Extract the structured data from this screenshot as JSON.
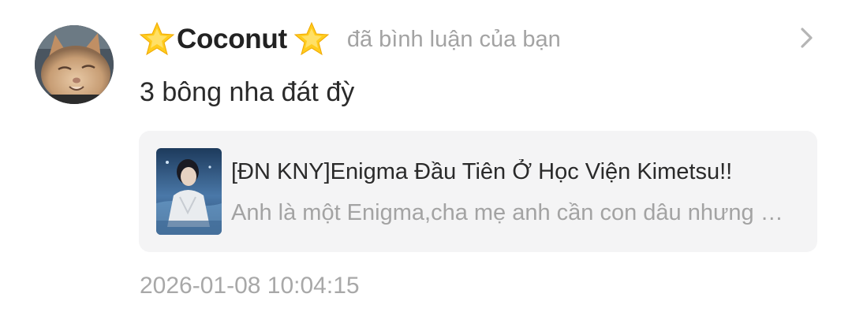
{
  "notification": {
    "user_name": "Coconut",
    "action": "đã bình luận của bạn",
    "comment": "3 bông nha đát đỳ",
    "story": {
      "title": "[ĐN KNY]Enigma Đầu Tiên Ở Học Viện Kimetsu!!",
      "description": "Anh là một Enigma,cha mẹ anh cần con dâu nhưng anh cũng chẳng biết phải làm sao"
    },
    "timestamp": "2026-01-08 10:04:15"
  },
  "icons": {
    "avatar": "cat-avatar",
    "name_decoration": "star-icon",
    "navigate": "chevron-right-icon",
    "cover": "book-cover-thumbnail"
  },
  "colors": {
    "username": "#222222",
    "secondary_text": "#a3a3a3",
    "card_background": "#f4f4f5",
    "star": "#ffcc1d"
  }
}
